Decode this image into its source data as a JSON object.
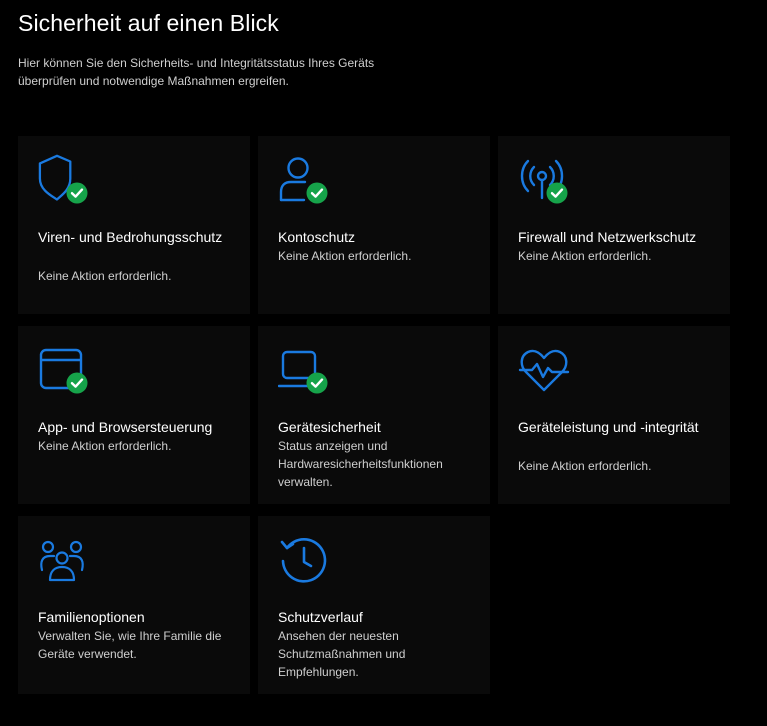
{
  "header": {
    "title": "Sicherheit auf einen Blick",
    "description": "Hier können Sie den Sicherheits- und Integritätsstatus Ihres Geräts überprüfen und notwendige Maßnahmen ergreifen."
  },
  "colors": {
    "accent": "#1a7ae0",
    "ok": "#16a34a",
    "tile_bg": "#0a0a0a",
    "page_bg": "#000000"
  },
  "tiles": [
    {
      "icon": "shield-icon",
      "title": "Viren- und Bedrohungsschutz",
      "status": "Keine Aktion erforderlich.",
      "check": true
    },
    {
      "icon": "account-icon",
      "title": "Kontoschutz",
      "status": "Keine Aktion erforderlich.",
      "check": true
    },
    {
      "icon": "network-icon",
      "title": "Firewall und Netzwerkschutz",
      "status": "Keine Aktion erforderlich.",
      "check": true
    },
    {
      "icon": "browser-icon",
      "title": "App- und Browsersteuerung",
      "status": "Keine Aktion erforderlich.",
      "check": true
    },
    {
      "icon": "laptop-icon",
      "title": "Gerätesicherheit",
      "status": "Status anzeigen und Hardwaresicherheitsfunktionen verwalten.",
      "check": true
    },
    {
      "icon": "heart-pulse-icon",
      "title": "Geräteleistung und -integrität",
      "status": "Keine Aktion erforderlich.",
      "check": false
    },
    {
      "icon": "family-icon",
      "title": "Familienoptionen",
      "status": "Verwalten Sie, wie Ihre Familie die Geräte verwendet.",
      "check": false
    },
    {
      "icon": "history-icon",
      "title": "Schutzverlauf",
      "status": "Ansehen der neuesten Schutzmaßnahmen und Empfehlungen.",
      "check": false
    }
  ]
}
